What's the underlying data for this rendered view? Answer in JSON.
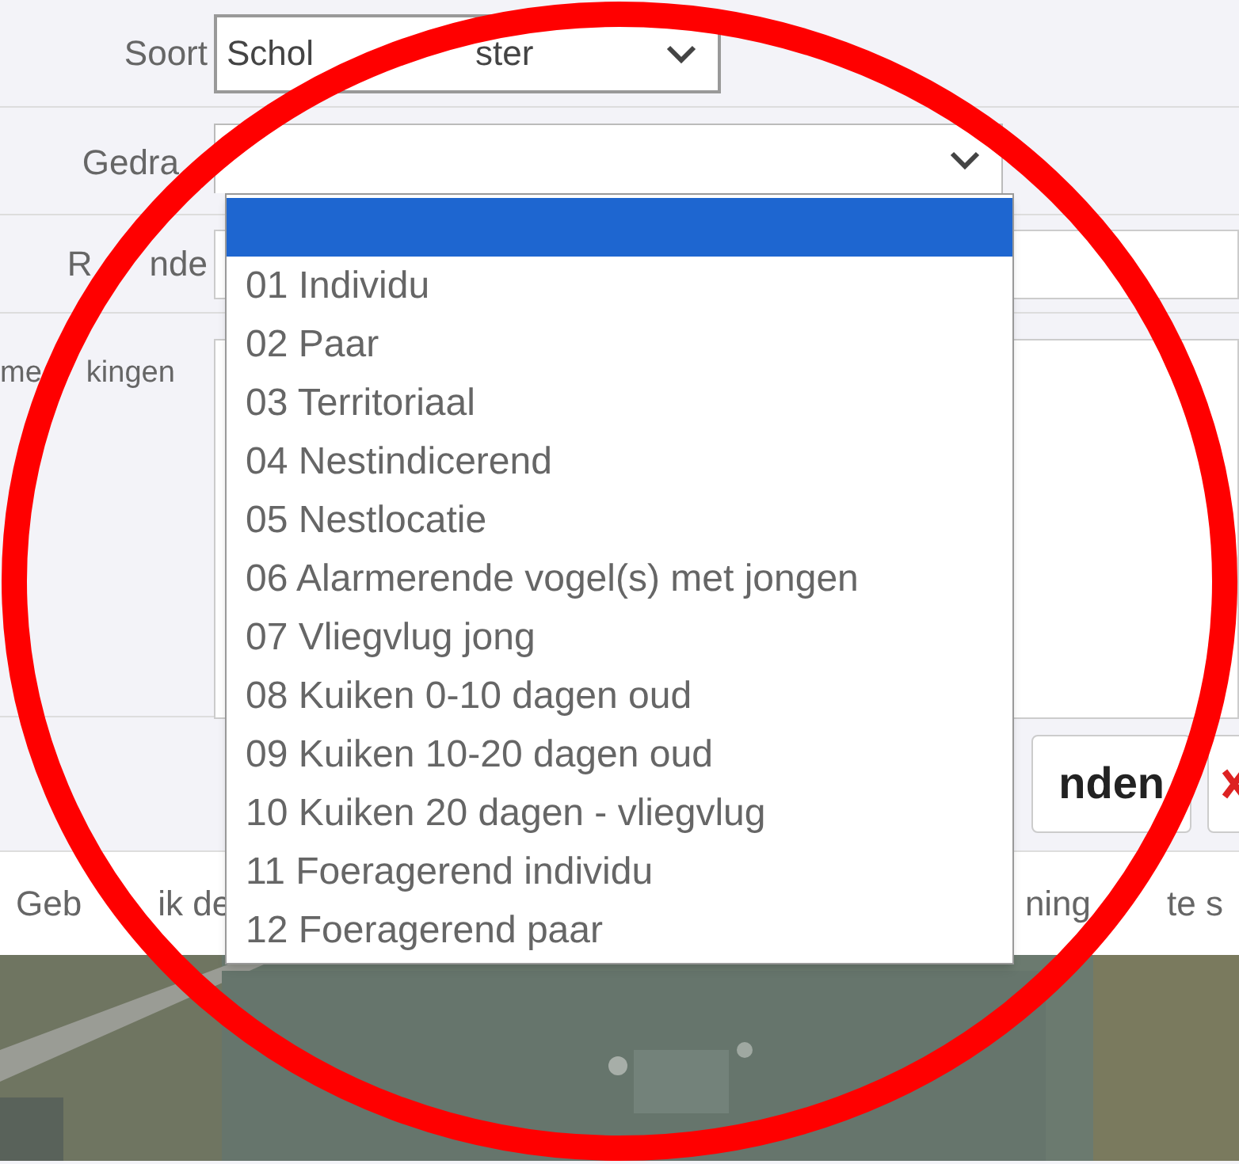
{
  "form": {
    "fields": [
      {
        "label_parts": [
          "Soort"
        ],
        "kind": "select",
        "value_parts": [
          "Schol",
          "ster"
        ]
      },
      {
        "label_parts": [
          "Gedra"
        ],
        "kind": "select",
        "expanded": true
      },
      {
        "label_parts": [
          "R",
          "nde"
        ],
        "kind": "input"
      },
      {
        "label_parts": [
          "me",
          "kingen"
        ],
        "kind": "textarea"
      }
    ]
  },
  "dropdown": {
    "options": [
      {
        "kind": "blank",
        "selected": true
      },
      {
        "kind": "option",
        "label": "01 Individu",
        "selected": false
      },
      {
        "kind": "option",
        "label": "02 Paar",
        "selected": false
      },
      {
        "kind": "option",
        "label": "03 Territoriaal",
        "selected": false
      },
      {
        "kind": "option",
        "label": "04 Nestindicerend",
        "selected": false
      },
      {
        "kind": "option",
        "label": "05 Nestlocatie",
        "selected": false
      },
      {
        "kind": "option",
        "label": "06 Alarmerende vogel(s) met jongen",
        "selected": false
      },
      {
        "kind": "option",
        "label": "07 Vliegvlug jong",
        "selected": false
      },
      {
        "kind": "option",
        "label": "08 Kuiken 0-10 dagen oud",
        "selected": false
      },
      {
        "kind": "option",
        "label": "09 Kuiken 10-20 dagen oud",
        "selected": false
      },
      {
        "kind": "option",
        "label": "10 Kuiken 20 dagen - vliegvlug",
        "selected": false
      },
      {
        "kind": "option",
        "label": "11 Foeragerend individu",
        "selected": false
      },
      {
        "kind": "option",
        "label": "12 Foeragerend paar",
        "selected": false
      }
    ]
  },
  "buttons": [
    {
      "kind": "text",
      "label": "nden"
    },
    {
      "kind": "close"
    }
  ],
  "hint": {
    "left_parts": [
      "Geb",
      "ik de"
    ],
    "right_parts": [
      "ning",
      "te s"
    ]
  },
  "annotation": {
    "kind": "circle",
    "color": "#ff0000"
  }
}
